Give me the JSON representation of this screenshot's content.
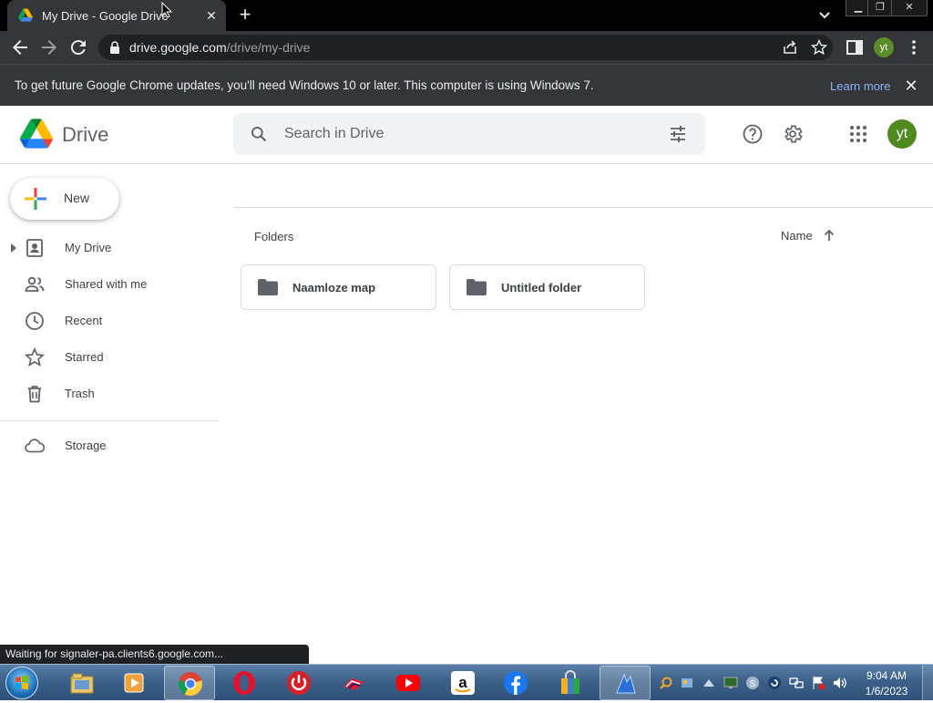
{
  "browser": {
    "tab_title": "My Drive - Google Drive",
    "url_host": "drive.google.com",
    "url_path": "/drive/my-drive",
    "profile_initials": "yt"
  },
  "infobar": {
    "message": "To get future Google Chrome updates, you'll need Windows 10 or later. This computer is using Windows 7.",
    "link": "Learn more"
  },
  "drive": {
    "app_name": "Drive",
    "search_placeholder": "Search in Drive",
    "avatar_initials": "yt",
    "new_label": "New",
    "nav": [
      {
        "label": "My Drive",
        "icon": "my-drive-icon"
      },
      {
        "label": "Shared with me",
        "icon": "shared-icon"
      },
      {
        "label": "Recent",
        "icon": "clock-icon"
      },
      {
        "label": "Starred",
        "icon": "star-icon"
      },
      {
        "label": "Trash",
        "icon": "trash-icon"
      },
      {
        "label": "Storage",
        "icon": "cloud-icon"
      }
    ],
    "folders_heading": "Folders",
    "sort_label": "Name",
    "folders": [
      "Naamloze map",
      "Untitled folder"
    ]
  },
  "status_text": "Waiting for signaler-pa.clients6.google.com...",
  "taskbar": {
    "time": "9:04 AM",
    "date": "1/6/2023"
  },
  "colors": {
    "chrome_dark": "#35363a",
    "link_blue": "#8ab4f8",
    "avatar_green": "#4e8a1f"
  }
}
